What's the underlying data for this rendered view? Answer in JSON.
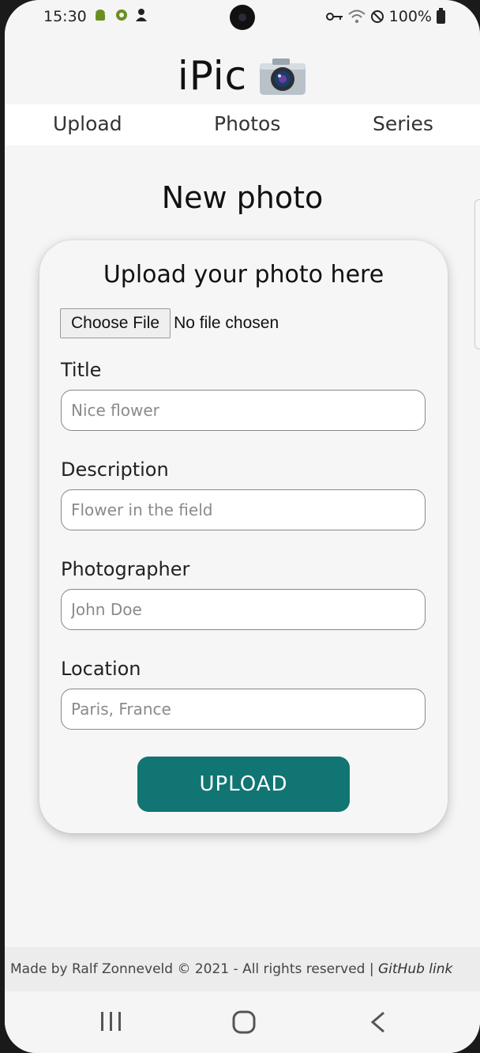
{
  "status_bar": {
    "time": "15:30",
    "battery": "100%"
  },
  "app": {
    "title": "iPic",
    "logo_icon": "camera-icon"
  },
  "nav": {
    "items": [
      {
        "label": "Upload"
      },
      {
        "label": "Photos"
      },
      {
        "label": "Series"
      }
    ]
  },
  "page": {
    "heading": "New photo"
  },
  "form": {
    "card_title": "Upload your photo here",
    "file_button": "Choose File",
    "file_status": "No file chosen",
    "fields": [
      {
        "label": "Title",
        "placeholder": "Nice flower"
      },
      {
        "label": "Description",
        "placeholder": "Flower in the field"
      },
      {
        "label": "Photographer",
        "placeholder": "John Doe"
      },
      {
        "label": "Location",
        "placeholder": "Paris, France"
      }
    ],
    "submit_label": "UPLOAD",
    "accent_color": "#107573"
  },
  "footer": {
    "text": "Made by Ralf Zonneveld © 2021 - All rights reserved | ",
    "link": "GitHub link"
  }
}
